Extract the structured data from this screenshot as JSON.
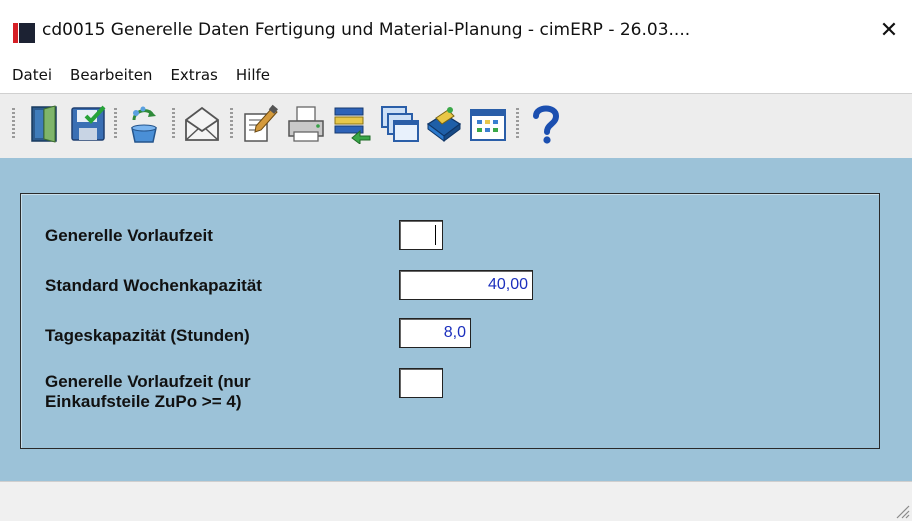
{
  "window": {
    "title": "cd0015 Generelle Daten Fertigung und Material-Planung - cimERP - 26.03....",
    "close_glyph": "✕"
  },
  "menu": [
    "Datei",
    "Bearbeiten",
    "Extras",
    "Hilfe"
  ],
  "toolbar": [
    {
      "icon": "exit-door-icon"
    },
    {
      "icon": "save-icon"
    },
    {
      "icon": "recycle-icon"
    },
    {
      "icon": "mail-icon"
    },
    {
      "icon": "edit-document-icon"
    },
    {
      "icon": "print-icon"
    },
    {
      "icon": "list-export-icon"
    },
    {
      "icon": "windows-icon"
    },
    {
      "icon": "book-icon"
    },
    {
      "icon": "calendar-icon"
    },
    {
      "icon": "help-icon"
    }
  ],
  "form": {
    "fields": [
      {
        "label": "Generelle Vorlaufzeit",
        "value": ""
      },
      {
        "label": "Standard Wochenkapazität",
        "value": "40,00"
      },
      {
        "label": "Tageskapazität (Stunden)",
        "value": "8,0"
      },
      {
        "label_line1": "Generelle Vorlaufzeit (nur",
        "label_line2": "Einkaufsteile ZuPo >= 4)",
        "value": ""
      }
    ]
  },
  "colors": {
    "client_bg": "#9cc2d8",
    "value_text": "#1b2fbd",
    "toolbar_bg": "#ededed"
  }
}
